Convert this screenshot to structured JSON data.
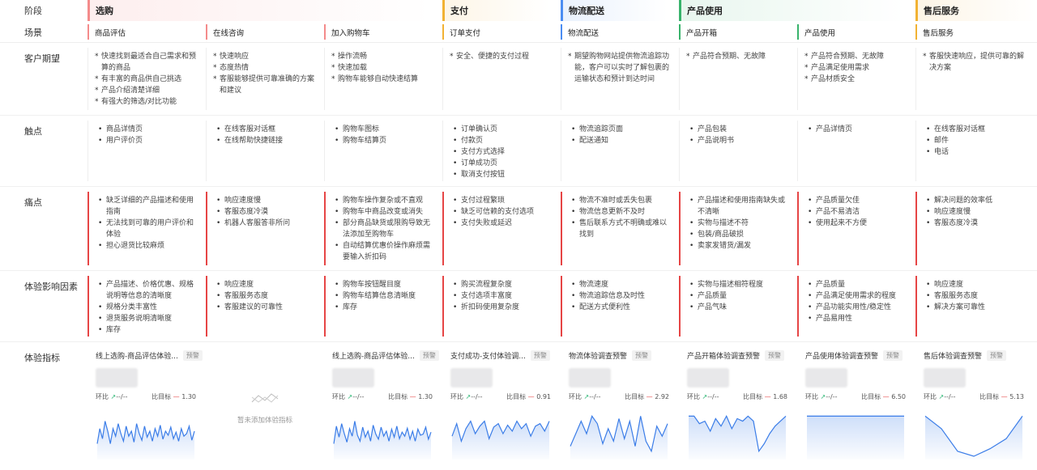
{
  "row_labels": {
    "stage": "阶段",
    "scene": "场景",
    "expectation": "客户期望",
    "touchpoint": "触点",
    "pain": "痛点",
    "factor": "体验影响因素",
    "metric": "体验指标"
  },
  "stages": [
    {
      "label": "选购",
      "color": "#f48b8b",
      "bg": "#fdeeee"
    },
    {
      "label": "支付",
      "color": "#f2b233",
      "bg": "#fdf5e6"
    },
    {
      "label": "物流配送",
      "color": "#4b8df2",
      "bg": "#eaf2fd"
    },
    {
      "label": "产品使用",
      "color": "#38b36b",
      "bg": "#e8f6ee"
    },
    {
      "label": "售后服务",
      "color": "#f2b233",
      "bg": "#fdf5e6"
    }
  ],
  "scenes": [
    "商品评估",
    "在线咨询",
    "加入购物车",
    "订单支付",
    "物流配送",
    "产品开箱",
    "产品使用",
    "售后服务"
  ],
  "expectations": [
    [
      "快速找到最适合自己需求和预算的商品",
      "有丰富的商品供自己挑选",
      "产品介绍清楚详细",
      "有强大的筛选/对比功能"
    ],
    [
      "快速响应",
      "态度热情",
      "客服能够提供可靠准确的方案和建议"
    ],
    [
      "操作流畅",
      "快速加载",
      "购物车能够自动快速结算"
    ],
    [
      "安全、便捷的支付过程"
    ],
    [
      "期望购物网站提供物流追踪功能，客户可以实时了解包裹的运输状态和预计到达时间"
    ],
    [
      "产品符合预期、无故障"
    ],
    [
      "产品符合预期、无故障",
      "产品满足使用需求",
      "产品材质安全"
    ],
    [
      "客服快速响应，提供可靠的解决方案"
    ]
  ],
  "touchpoints": [
    [
      "商品详情页",
      "用户评价页"
    ],
    [
      "在线客服对话框",
      "在线帮助快捷链接"
    ],
    [
      "购物车图标",
      "购物车结算页"
    ],
    [
      "订单确认页",
      "付款页",
      "支付方式选择",
      "订单成功页",
      "取消支付按钮"
    ],
    [
      "物流追踪页面",
      "配送通知"
    ],
    [
      "产品包装",
      "产品说明书"
    ],
    [
      "产品详情页"
    ],
    [
      "在线客服对话框",
      "邮件",
      "电话"
    ]
  ],
  "pains": [
    [
      "缺乏详细的产品描述和使用指南",
      "无法找到可靠的用户评价和体验",
      "担心退货比较麻烦"
    ],
    [
      "响应速度慢",
      "客服态度冷漠",
      "机器人客服答非所问"
    ],
    [
      "购物车操作复杂或不直观",
      "购物车中商品改变或消失",
      "部分商品缺货或限购导致无法添加至购物车",
      "自动结算优惠价操作麻烦需要输入折扣码"
    ],
    [
      "支付过程繁琐",
      "缺乏可信赖的支付选项",
      "支付失败或延迟"
    ],
    [
      "物流不准时或丢失包裹",
      "物流信息更新不及时",
      "售后联系方式不明确或难以找到"
    ],
    [
      "产品描述和使用指南缺失或不清晰",
      "实物与描述不符",
      "包装/商品破损",
      "卖家发错货/漏发"
    ],
    [
      "产品质量欠佳",
      "产品不易清洁",
      "使用起来不方便"
    ],
    [
      "解决问题的效率低",
      "响应速度慢",
      "客服态度冷漠"
    ]
  ],
  "factors": [
    [
      "产品描述、价格优惠、规格说明等信息的清晰度",
      "规格分类丰富性",
      "退货服务说明清晰度",
      "库存"
    ],
    [
      "响应速度",
      "客服服务态度",
      "客服建议的可靠性"
    ],
    [
      "购物车按钮醒目度",
      "购物车结算信息清晰度",
      "库存"
    ],
    [
      "购买流程复杂度",
      "支付选项丰富度",
      "折扣码使用复杂度"
    ],
    [
      "物流速度",
      "物流追踪信息及时性",
      "配送方式便利性"
    ],
    [
      "实物与描述相符程度",
      "产品质量",
      "产品气味"
    ],
    [
      "产品质量",
      "产品满足使用需求的程度",
      "产品功能实用性/稳定性",
      "产品易用性"
    ],
    [
      "响应速度",
      "客服服务态度",
      "解决方案可靠性"
    ]
  ],
  "metrics": [
    {
      "title": "线上选购-商品评估体验...",
      "tag": "预警",
      "ring_label": "环比",
      "ring_value": "--/--",
      "target_label": "比目标",
      "target_value": "1.30",
      "series": [
        0.75,
        0.45,
        0.65,
        0.3,
        0.5,
        0.75,
        0.45,
        0.6,
        0.35,
        0.55,
        0.7,
        0.4,
        0.6,
        0.5,
        0.72,
        0.35,
        0.55,
        0.68,
        0.4,
        0.62,
        0.5,
        0.7,
        0.45,
        0.6,
        0.38,
        0.66,
        0.5,
        0.58,
        0.42,
        0.65,
        0.52,
        0.7,
        0.45,
        0.6,
        0.55,
        0.4,
        0.68,
        0.5
      ]
    },
    {
      "empty": true,
      "empty_text": "暂未添加体验指标"
    },
    {
      "title": "线上选购-商品评估体验...",
      "tag": "预警",
      "ring_label": "环比",
      "ring_value": "--/--",
      "target_label": "比目标",
      "target_value": "1.30",
      "series": [
        0.75,
        0.4,
        0.62,
        0.35,
        0.55,
        0.72,
        0.45,
        0.6,
        0.3,
        0.58,
        0.7,
        0.42,
        0.62,
        0.5,
        0.7,
        0.38,
        0.56,
        0.66,
        0.42,
        0.6,
        0.5,
        0.7,
        0.46,
        0.62,
        0.4,
        0.65,
        0.52,
        0.6,
        0.44,
        0.66,
        0.5,
        0.7,
        0.46,
        0.58,
        0.56,
        0.42,
        0.66,
        0.52
      ]
    },
    {
      "title": "支付成功-支付体验调...",
      "tag": "预警",
      "ring_label": "环比",
      "ring_value": "--/--",
      "target_label": "比目标",
      "target_value": "0.91",
      "series": [
        0.6,
        0.35,
        0.7,
        0.45,
        0.3,
        0.55,
        0.4,
        0.3,
        0.65,
        0.42,
        0.35,
        0.55,
        0.38,
        0.5,
        0.3,
        0.45,
        0.35,
        0.6,
        0.4,
        0.35,
        0.5,
        0.3
      ]
    },
    {
      "title": "物流体验调查预警",
      "tag": "预警",
      "ring_label": "环比",
      "ring_value": "--/--",
      "target_label": "比目标",
      "target_value": "2.92",
      "series": [
        0.8,
        0.55,
        0.3,
        0.55,
        0.2,
        0.35,
        0.75,
        0.45,
        0.7,
        0.25,
        0.65,
        0.3,
        0.8,
        0.2,
        0.7,
        0.9,
        0.4,
        0.6,
        0.35
      ]
    },
    {
      "title": "产品开箱体验调查预警",
      "tag": "预警",
      "ring_label": "环比",
      "ring_value": "--/--",
      "target_label": "比目标",
      "target_value": "1.68",
      "series": [
        0.2,
        0.2,
        0.35,
        0.3,
        0.5,
        0.25,
        0.4,
        0.2,
        0.45,
        0.25,
        0.3,
        0.2,
        0.3,
        0.9,
        0.75,
        0.55,
        0.4,
        0.3,
        0.2
      ]
    },
    {
      "title": "产品使用体验调查预警",
      "tag": "预警",
      "ring_label": "环比",
      "ring_value": "--/--",
      "target_label": "比目标",
      "target_value": "6.50",
      "series": [
        0.2,
        0.2
      ]
    },
    {
      "title": "售后体验调查预警",
      "tag": "预警",
      "ring_label": "环比",
      "ring_value": "--/--",
      "target_label": "比目标",
      "target_value": "5.13",
      "series": [
        0.2,
        0.45,
        0.9,
        1.0,
        0.85,
        0.65,
        0.2
      ]
    }
  ],
  "colors": {
    "red": "#e64545",
    "line": "#3b7de8",
    "up": "#2bb673"
  }
}
